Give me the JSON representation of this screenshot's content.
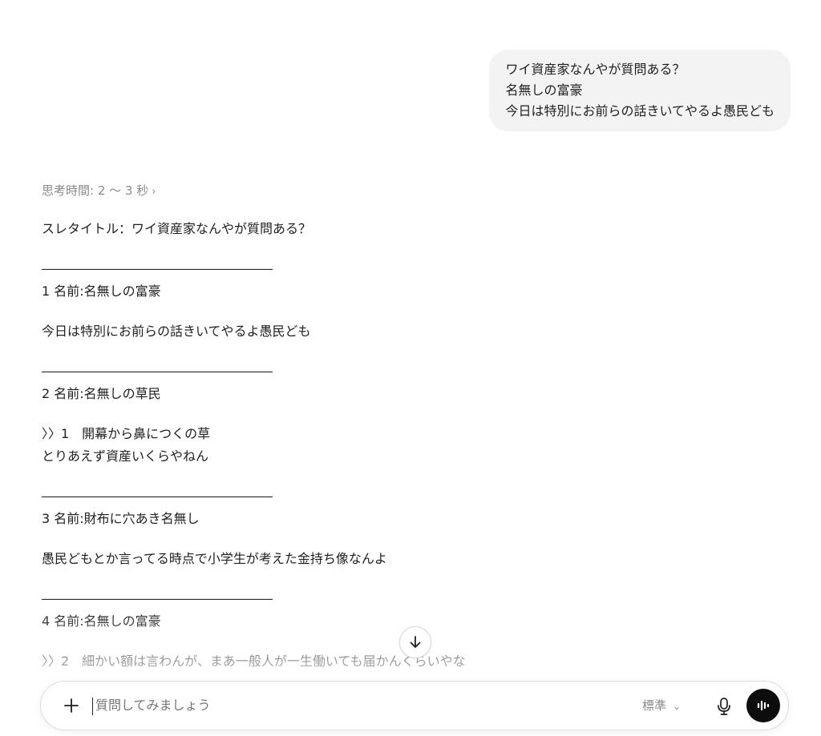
{
  "user_message": {
    "lines": [
      "ワイ資産家なんやが質問ある？",
      "名無しの富豪",
      "今日は特別にお前らの話きいてやるよ愚民ども"
    ]
  },
  "thinking": {
    "label": "思考時間: 2 〜 3 秒",
    "chevron": "›"
  },
  "answer": {
    "thread_title": "スレタイトル：ワイ資産家なんやが質問ある？",
    "separator": "――――――――――――――――――",
    "posts": [
      {
        "header": "1 名前:名無しの富豪",
        "body": [
          "今日は特別にお前らの話きいてやるよ愚民ども"
        ]
      },
      {
        "header": "2 名前:名無しの草民",
        "body": [
          "〉〉1　開幕から鼻につくの草",
          "とりあえず資産いくらやねん"
        ]
      },
      {
        "header": "3 名前:財布に穴あき名無し",
        "body": [
          "愚民どもとか言ってる時点で小学生が考えた金持ち像なんよ"
        ]
      },
      {
        "header": "4 名前:名無しの富豪",
        "body": [
          "〉〉2　細かい額は言わんが、まあ一般人が一生働いても届かんくらいやな"
        ]
      }
    ]
  },
  "composer": {
    "placeholder": "質問してみましょう",
    "model_label": "標準",
    "model_chevron": "⌄"
  },
  "icons": {
    "plus": "plus-icon",
    "mic": "microphone-icon",
    "voice": "voice-mode-icon",
    "scroll": "arrow-down-icon"
  }
}
